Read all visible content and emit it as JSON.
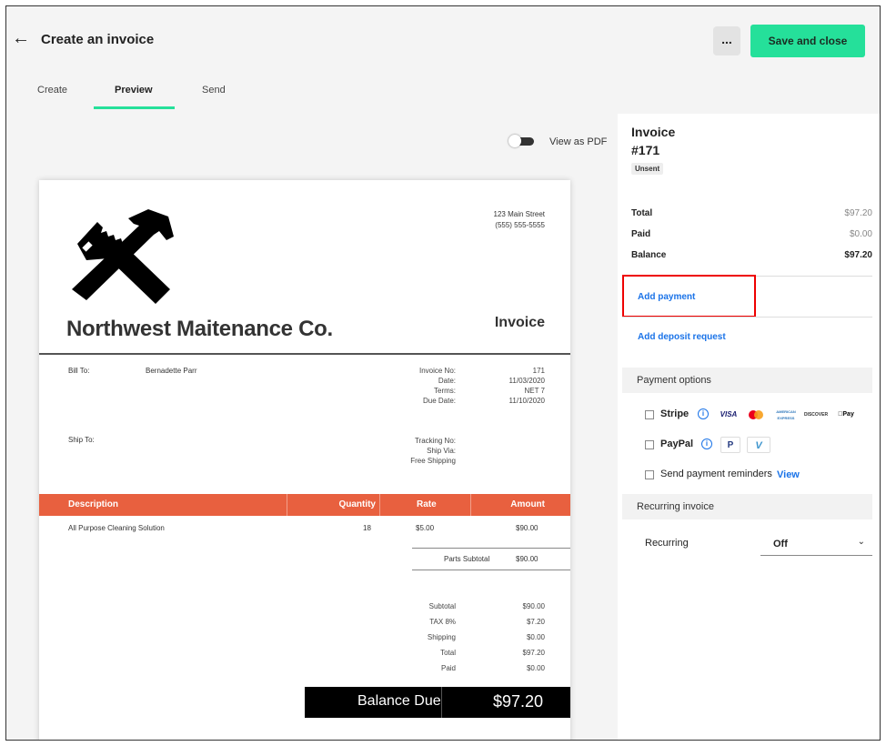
{
  "header": {
    "back_icon": "arrow-left-icon",
    "title": "Create an invoice",
    "more_label": "...",
    "save_label": "Save and close",
    "accent_color": "#25e09a"
  },
  "tabs": [
    {
      "label": "Create"
    },
    {
      "label": "Preview",
      "active": true
    },
    {
      "label": "Send"
    }
  ],
  "preview": {
    "toggle_label": "View as PDF",
    "toggle_on": false
  },
  "invoice_doc": {
    "address_line1": "123 Main Street",
    "address_line2": "(555) 555-5555",
    "company": "Northwest Maitenance Co.",
    "heading": "Invoice",
    "bill_to_label": "Bill To:",
    "bill_to_name": "Bernadette Parr",
    "ship_to_label": "Ship To:",
    "meta_labels": [
      "Invoice No:",
      "Date:",
      "Terms:",
      "Due Date:"
    ],
    "meta_values": [
      "171",
      "11/03/2020",
      "NET 7",
      "11/10/2020"
    ],
    "ship_labels": [
      "Tracking No:",
      "Ship Via:",
      "Free Shipping"
    ],
    "columns": [
      "Description",
      "Quantity",
      "Rate",
      "Amount"
    ],
    "header_color": "#e8603f",
    "rows": [
      {
        "description": "All Purpose Cleaning Solution",
        "quantity": "18",
        "rate": "$5.00",
        "amount": "$90.00"
      }
    ],
    "parts_subtotal_label": "Parts Subtotal",
    "parts_subtotal_value": "$90.00",
    "totals_labels": [
      "Subtotal",
      "TAX 8%",
      "Shipping",
      "Total",
      "Paid"
    ],
    "totals_values": [
      "$90.00",
      "$7.20",
      "$0.00",
      "$97.20",
      "$0.00"
    ],
    "balance_due_label": "Balance Due",
    "balance_due_value": "$97.20"
  },
  "sidebar": {
    "title": "Invoice",
    "number": "#171",
    "status": "Unsent",
    "total_label": "Total",
    "total_value": "$97.20",
    "paid_label": "Paid",
    "paid_value": "$0.00",
    "balance_label": "Balance",
    "balance_value": "$97.20",
    "add_payment": "Add payment",
    "add_deposit": "Add deposit request",
    "payment_options": "Payment options",
    "stripe_label": "Stripe",
    "stripe_cards": [
      "VISA",
      "mastercard",
      "AMERICAN EXPRESS",
      "DISCOVER",
      "Pay"
    ],
    "paypal_label": "PayPal",
    "paypal_marks": [
      "P",
      "V"
    ],
    "reminders_label": "Send payment reminders",
    "reminders_link": "View",
    "recurring_section": "Recurring invoice",
    "recurring_label": "Recurring",
    "recurring_value": "Off",
    "link_color": "#1a73e8"
  }
}
